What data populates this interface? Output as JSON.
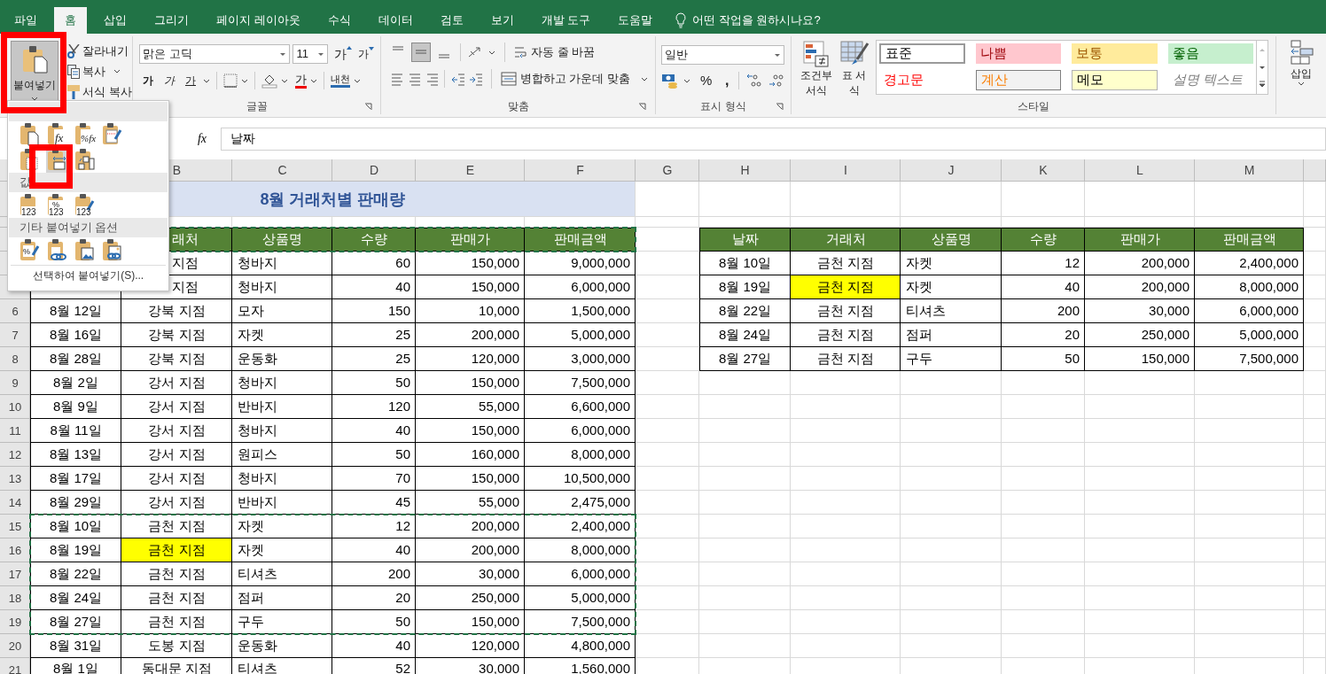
{
  "tabs": [
    {
      "label": "파일",
      "selected": false
    },
    {
      "label": "홈",
      "selected": true
    },
    {
      "label": "삽입",
      "selected": false
    },
    {
      "label": "그리기",
      "selected": false
    },
    {
      "label": "페이지 레이아웃",
      "selected": false
    },
    {
      "label": "수식",
      "selected": false
    },
    {
      "label": "데이터",
      "selected": false
    },
    {
      "label": "검토",
      "selected": false
    },
    {
      "label": "보기",
      "selected": false
    },
    {
      "label": "개발 도구",
      "selected": false
    },
    {
      "label": "도움말",
      "selected": false
    }
  ],
  "tell_me": "어떤 작업을 원하시나요?",
  "ribbon": {
    "clipboard": {
      "paste": {
        "label": "붙여넣기",
        "pressed": true
      },
      "cut": "잘라내기",
      "copy": "복사",
      "format_painter": "서식 복사"
    },
    "font": {
      "name": "맑은 고딕",
      "size": "11",
      "grow": "가",
      "shrink": "가",
      "bold": "가",
      "italic": "가",
      "underline": "가",
      "font_color": "가",
      "phonetic": "내천",
      "label": "글꼴"
    },
    "alignment": {
      "middle_align_on": true,
      "wrap": "자동 줄 바꿈",
      "merge": "병합하고 가운데 맞춤",
      "label": "맞춤"
    },
    "number": {
      "format": "일반",
      "percent": "%",
      "comma": ",",
      "label": "표시 형식"
    },
    "styles": {
      "conditional": "조건부 서식",
      "table": "표 서식",
      "gallery": [
        {
          "label": "표준",
          "kind": "normal"
        },
        {
          "label": "나쁨",
          "kind": "bad"
        },
        {
          "label": "보통",
          "kind": "neutral"
        },
        {
          "label": "좋음",
          "kind": "good"
        },
        {
          "label": "경고문",
          "kind": "warning"
        },
        {
          "label": "계산",
          "kind": "calculation"
        },
        {
          "label": "메모",
          "kind": "note"
        },
        {
          "label": "설명 텍스트",
          "kind": "explanatory"
        }
      ],
      "label": "스타일"
    },
    "cells": {
      "insert": "삽입"
    }
  },
  "paste_menu": {
    "sections": [
      {
        "options": [
          {
            "kind": "paste",
            "selected": false
          },
          {
            "kind": "formulas",
            "glyph": "fx",
            "selected": false
          },
          {
            "kind": "formulas-number-format",
            "glyph": "%fx",
            "selected": false
          },
          {
            "kind": "keep-source-formatting",
            "selected": false
          },
          {
            "kind": "no-borders",
            "selected": false
          },
          {
            "kind": "keep-column-widths",
            "selected": true
          },
          {
            "kind": "transpose",
            "selected": false
          }
        ]
      },
      {
        "title": "값",
        "options": [
          {
            "kind": "values",
            "glyph": "123",
            "selected": false
          },
          {
            "kind": "values-number-format",
            "glyph": "%",
            "sub": "123",
            "selected": false
          },
          {
            "kind": "values-source-formatting",
            "glyph": "123",
            "selected": false
          }
        ]
      },
      {
        "title": "기타 붙여넣기 옵션",
        "options": [
          {
            "kind": "formatting",
            "glyph": "%",
            "selected": false
          },
          {
            "kind": "paste-link",
            "selected": false
          },
          {
            "kind": "picture",
            "selected": false
          },
          {
            "kind": "linked-picture",
            "selected": false
          }
        ]
      }
    ],
    "footer": "선택하여 붙여넣기(S)..."
  },
  "formula_bar": {
    "fx": "fx",
    "value": "날짜"
  },
  "sheet": {
    "column_headers": {
      "B": "B",
      "C": "C",
      "D": "D",
      "E": "E",
      "F": "F",
      "G": "G",
      "H": "H",
      "I": "I",
      "J": "J",
      "K": "K",
      "L": "L",
      "M": "M"
    },
    "rows": [
      {
        "kind": "title",
        "title": "8월 거래처별 판매량",
        "copied": false,
        "cells": {}
      },
      {
        "kind": "blank",
        "copied": false,
        "cells": {}
      },
      {
        "kind": "header",
        "copied": true,
        "cells": {
          "B": {
            "text": "래처",
            "clipped": true
          },
          "C": "상품명",
          "D": "수량",
          "E": "판매가",
          "F": "판매금액",
          "H": "날짜",
          "I": "거래처",
          "J": "상품명",
          "K": "수량",
          "L": "판매가",
          "M": "판매금액"
        }
      },
      {
        "kind": "data",
        "copied": false,
        "cells": {
          "B": {
            "text": "지점",
            "clipped": true
          },
          "C": "청바지",
          "D": "60",
          "E": "150,000",
          "F": "9,000,000",
          "H": "8월 10일",
          "I": "금천 지점",
          "J": "자켓",
          "K": "12",
          "L": "200,000",
          "M": "2,400,000"
        }
      },
      {
        "kind": "data",
        "copied": false,
        "cells": {
          "B": {
            "text": "지점",
            "clipped": true
          },
          "C": "청바지",
          "D": "40",
          "E": "150,000",
          "F": "6,000,000",
          "H": "8월 19일",
          "I": {
            "text": "금천 지점",
            "highlighted": true
          },
          "J": "자켓",
          "K": "40",
          "L": "200,000",
          "M": "8,000,000"
        }
      },
      {
        "number": "6",
        "kind": "data",
        "copied": false,
        "cells": {
          "A": "8월 12일",
          "B": "강북 지점",
          "C": "모자",
          "D": "150",
          "E": "10,000",
          "F": "1,500,000",
          "H": "8월 22일",
          "I": "금천 지점",
          "J": "티셔츠",
          "K": "200",
          "L": "30,000",
          "M": "6,000,000"
        }
      },
      {
        "number": "7",
        "kind": "data",
        "copied": false,
        "cells": {
          "A": "8월 16일",
          "B": "강북 지점",
          "C": "자켓",
          "D": "25",
          "E": "200,000",
          "F": "5,000,000",
          "H": "8월 24일",
          "I": "금천 지점",
          "J": "점퍼",
          "K": "20",
          "L": "250,000",
          "M": "5,000,000"
        }
      },
      {
        "number": "8",
        "kind": "data",
        "copied": false,
        "cells": {
          "A": "8월 28일",
          "B": "강북 지점",
          "C": "운동화",
          "D": "25",
          "E": "120,000",
          "F": "3,000,000",
          "H": "8월 27일",
          "I": "금천 지점",
          "J": "구두",
          "K": "50",
          "L": "150,000",
          "M": "7,500,000"
        }
      },
      {
        "number": "9",
        "kind": "data",
        "copied": false,
        "cells": {
          "A": "8월 2일",
          "B": "강서 지점",
          "C": "청바지",
          "D": "50",
          "E": "150,000",
          "F": "7,500,000"
        }
      },
      {
        "number": "10",
        "kind": "data",
        "copied": false,
        "cells": {
          "A": "8월 9일",
          "B": "강서 지점",
          "C": "반바지",
          "D": "120",
          "E": "55,000",
          "F": "6,600,000"
        }
      },
      {
        "number": "11",
        "kind": "data",
        "copied": false,
        "cells": {
          "A": "8월 11일",
          "B": "강서 지점",
          "C": "청바지",
          "D": "40",
          "E": "150,000",
          "F": "6,000,000"
        }
      },
      {
        "number": "12",
        "kind": "data",
        "copied": false,
        "cells": {
          "A": "8월 13일",
          "B": "강서 지점",
          "C": "원피스",
          "D": "50",
          "E": "160,000",
          "F": "8,000,000"
        }
      },
      {
        "number": "13",
        "kind": "data",
        "copied": false,
        "cells": {
          "A": "8월 17일",
          "B": "강서 지점",
          "C": "청바지",
          "D": "70",
          "E": "150,000",
          "F": "10,500,000"
        }
      },
      {
        "number": "14",
        "kind": "data",
        "copied": false,
        "cells": {
          "A": "8월 29일",
          "B": "강서 지점",
          "C": "반바지",
          "D": "45",
          "E": "55,000",
          "F": "2,475,000"
        }
      },
      {
        "number": "15",
        "kind": "data",
        "copied": true,
        "cells": {
          "A": "8월 10일",
          "B": "금천 지점",
          "C": "자켓",
          "D": "12",
          "E": "200,000",
          "F": "2,400,000"
        }
      },
      {
        "number": "16",
        "kind": "data",
        "copied": true,
        "cells": {
          "A": "8월 19일",
          "B": {
            "text": "금천 지점",
            "highlighted": true
          },
          "C": "자켓",
          "D": "40",
          "E": "200,000",
          "F": "8,000,000"
        }
      },
      {
        "number": "17",
        "kind": "data",
        "copied": true,
        "cells": {
          "A": "8월 22일",
          "B": "금천 지점",
          "C": "티셔츠",
          "D": "200",
          "E": "30,000",
          "F": "6,000,000"
        }
      },
      {
        "number": "18",
        "kind": "data",
        "copied": true,
        "cells": {
          "A": "8월 24일",
          "B": "금천 지점",
          "C": "점퍼",
          "D": "20",
          "E": "250,000",
          "F": "5,000,000"
        }
      },
      {
        "number": "19",
        "kind": "data",
        "copied": true,
        "cells": {
          "A": "8월 27일",
          "B": "금천 지점",
          "C": "구두",
          "D": "50",
          "E": "150,000",
          "F": "7,500,000"
        }
      },
      {
        "number": "20",
        "kind": "data",
        "copied": false,
        "cells": {
          "A": "8월 31일",
          "B": "도봉 지점",
          "C": "운동화",
          "D": "40",
          "E": "120,000",
          "F": "4,800,000"
        }
      },
      {
        "number": "21",
        "kind": "data",
        "copied": false,
        "cells": {
          "A": "8월 1일",
          "B": "동대문 지점",
          "C": "티셔츠",
          "D": "52",
          "E": "30,000",
          "F": "1,560,000"
        }
      }
    ]
  }
}
